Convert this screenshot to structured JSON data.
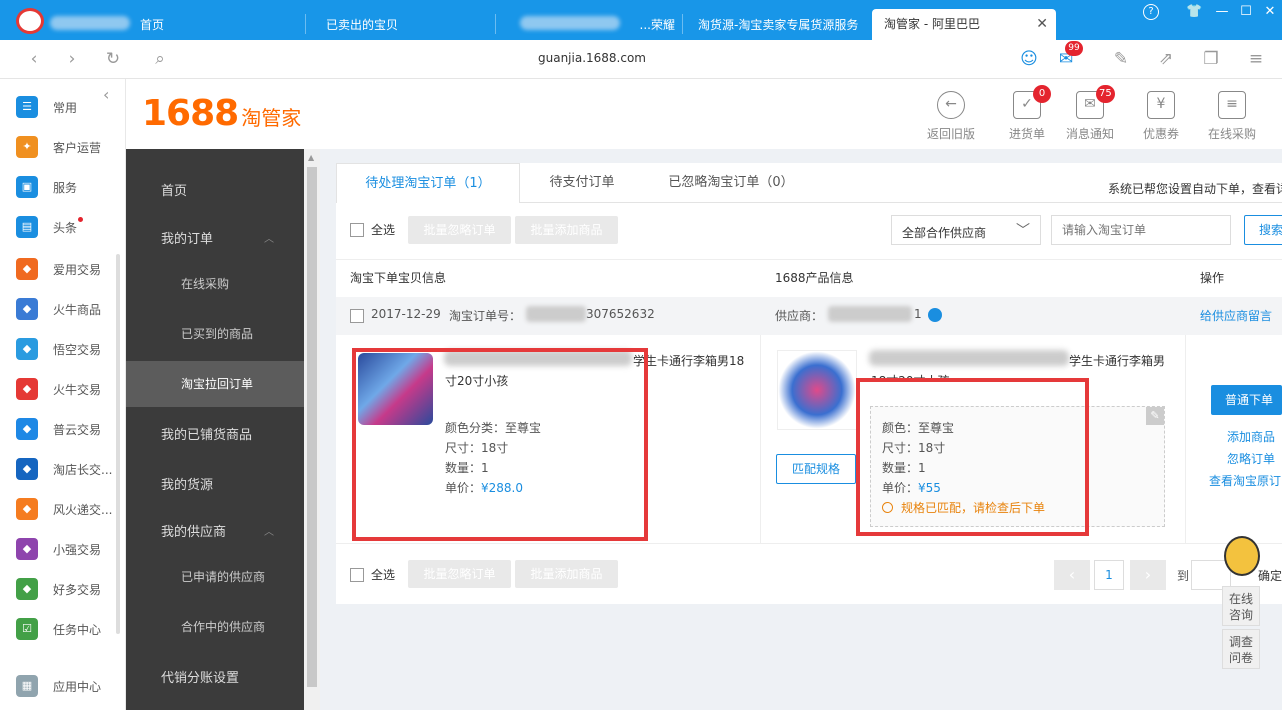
{
  "browser": {
    "tabs": [
      {
        "label": "首页"
      },
      {
        "label": "已卖出的宝贝"
      },
      {
        "label": "...荣耀"
      },
      {
        "label": "淘货源-淘宝卖家专属货源服务"
      },
      {
        "label": "淘管家 - 阿里巴巴"
      }
    ],
    "url": "guanjia.1688.com",
    "mail_badge": "99"
  },
  "rail": {
    "items": [
      {
        "label": "常用",
        "icon": "list-icon",
        "color": "#1a8ee0"
      },
      {
        "label": "客户运营",
        "icon": "star-icon",
        "color": "#f09020"
      },
      {
        "label": "服务",
        "icon": "bag-icon",
        "color": "#1a8ee0"
      },
      {
        "label": "头条",
        "icon": "news-icon",
        "color": "#1a8ee0"
      },
      {
        "label": "爱用交易",
        "icon": "app-icon",
        "color": "#f06a20"
      },
      {
        "label": "火牛商品",
        "icon": "app-icon",
        "color": "#3a7bd5"
      },
      {
        "label": "悟空交易",
        "icon": "app-icon",
        "color": "#2a9be0"
      },
      {
        "label": "火牛交易",
        "icon": "app-icon",
        "color": "#e53935"
      },
      {
        "label": "普云交易",
        "icon": "app-icon",
        "color": "#1e88e5"
      },
      {
        "label": "淘店长交...",
        "icon": "app-icon",
        "color": "#1565c0"
      },
      {
        "label": "风火递交...",
        "icon": "app-icon",
        "color": "#f57c20"
      },
      {
        "label": "小强交易",
        "icon": "app-icon",
        "color": "#8e44ad"
      },
      {
        "label": "好多交易",
        "icon": "app-icon",
        "color": "#43a047"
      },
      {
        "label": "任务中心",
        "icon": "task-icon",
        "color": "#43a047"
      },
      {
        "label": "应用中心",
        "icon": "grid-icon",
        "color": "#90a4ae"
      }
    ]
  },
  "header": {
    "logo_number": "1688",
    "logo_text": "淘管家",
    "buttons": [
      {
        "label": "返回旧版",
        "icon": "back-icon",
        "badge": ""
      },
      {
        "label": "进货单",
        "icon": "order-icon",
        "badge": "0"
      },
      {
        "label": "消息通知",
        "icon": "mail-icon",
        "badge": "75"
      },
      {
        "label": "优惠券",
        "icon": "coupon-icon",
        "badge": ""
      },
      {
        "label": "在线采购",
        "icon": "doc-icon",
        "badge": ""
      }
    ]
  },
  "sidebar": {
    "items": [
      {
        "label": "首页"
      },
      {
        "label": "我的订单"
      },
      {
        "label": "在线采购"
      },
      {
        "label": "已买到的商品"
      },
      {
        "label": "淘宝拉回订单"
      },
      {
        "label": "我的已铺货商品"
      },
      {
        "label": "我的货源"
      },
      {
        "label": "我的供应商"
      },
      {
        "label": "已申请的供应商"
      },
      {
        "label": "合作中的供应商"
      },
      {
        "label": "代销分账设置"
      }
    ]
  },
  "tabs": [
    {
      "label": "待处理淘宝订单（1）"
    },
    {
      "label": "待支付订单"
    },
    {
      "label": "已忽略淘宝订单（0）"
    }
  ],
  "auto_notice": "系统已帮您设置自动下单，查看详",
  "toolbar": {
    "select_all": "全选",
    "batch_ignore": "批量忽略订单",
    "batch_add": "批量添加商品",
    "supplier_select": "全部合作供应商",
    "order_placeholder": "请输入淘宝订单",
    "search": "搜索"
  },
  "table": {
    "col_taobao": "淘宝下单宝贝信息",
    "col_1688": "1688产品信息",
    "col_action": "操作",
    "order": {
      "date": "2017-12-29",
      "order_no_label": "淘宝订单号：",
      "order_no": "307652632",
      "supplier_label": "供应商：",
      "supplier_suffix": "1",
      "message_link": "给供应商留言"
    },
    "taobao_item": {
      "title_tail": "学生卡通行李箱男18",
      "title_line2": "寸20寸小孩",
      "color": "颜色分类：至尊宝",
      "size": "尺寸：18寸",
      "qty": "数量：1",
      "price_label": "单价：",
      "price": "¥288.0"
    },
    "product_1688": {
      "title_tail": "学生卡通行李箱男",
      "title_line2": "18寸20寸小孩",
      "match_button": "匹配规格",
      "color": "颜色：至尊宝",
      "size": "尺寸：18寸",
      "qty": "数量：1",
      "price_label": "单价：",
      "price": "¥55",
      "match_status": "规格已匹配，请检查后下单"
    },
    "actions": {
      "order_button": "普通下单",
      "add_product": "添加商品",
      "ignore_order": "忽略订单",
      "view_original": "查看淘宝原订"
    }
  },
  "pagination": {
    "current": "1",
    "goto_label": "到",
    "confirm": "确定"
  },
  "float_widget": {
    "chat": "在线咨询",
    "survey": "调查问卷"
  },
  "colors": {
    "tabbar": "#1896e8",
    "sidebar": "#3b3b3b",
    "accent": "#1a8ee0",
    "logo": "#ff6a00",
    "highlight_border": "#e5393a",
    "match_status": "#e8830c"
  }
}
